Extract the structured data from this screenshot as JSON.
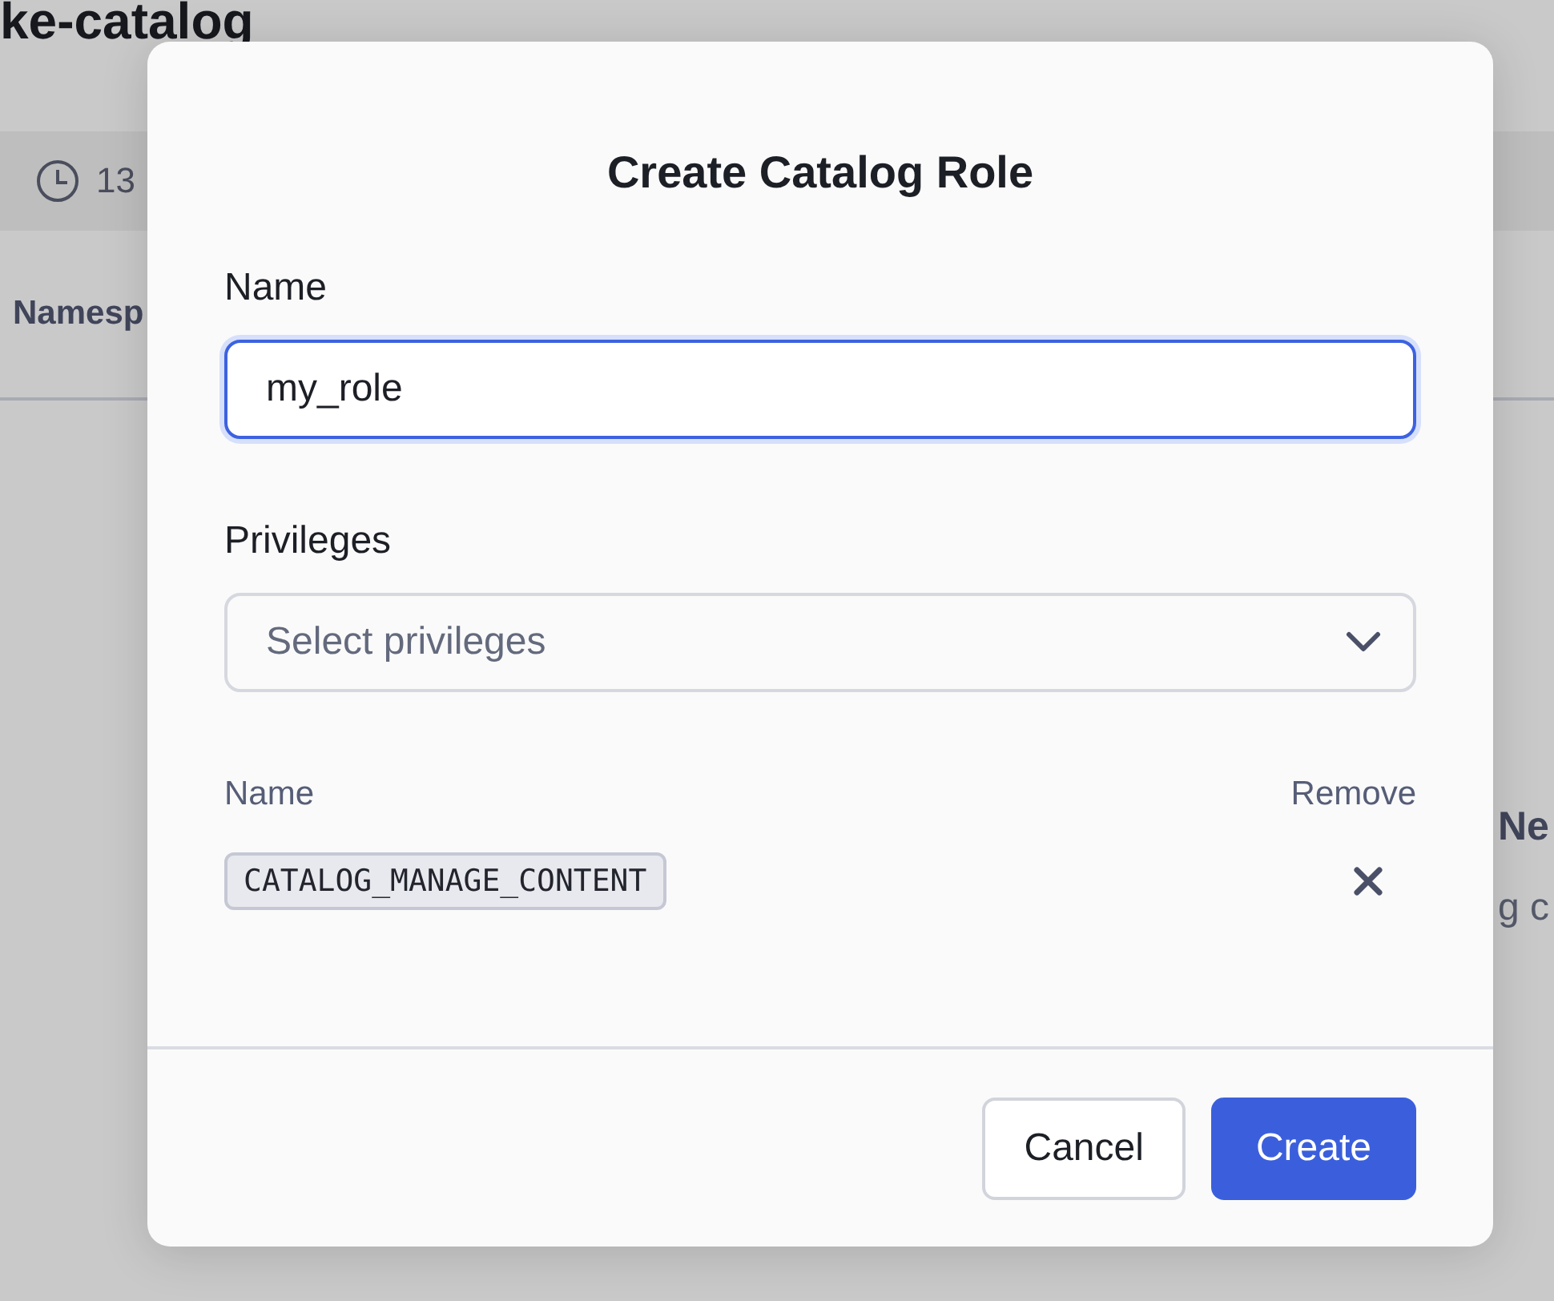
{
  "page": {
    "title": "ke-catalog",
    "timestamp": "13",
    "column_1": "Namesp",
    "empty_title": "Ne",
    "empty_text": "g c"
  },
  "dialog": {
    "title": "Create Catalog Role",
    "name_field": {
      "label": "Name",
      "value": "my_role",
      "focused": true
    },
    "privileges_field": {
      "label": "Privileges",
      "placeholder": "Select privileges"
    },
    "table": {
      "columns": [
        "Name",
        "Remove"
      ],
      "rows": [
        {
          "name": "CATALOG_MANAGE_CONTENT"
        }
      ]
    },
    "buttons": [
      {
        "label": "Cancel",
        "kind": "secondary"
      },
      {
        "label": "Create",
        "kind": "primary"
      }
    ]
  }
}
